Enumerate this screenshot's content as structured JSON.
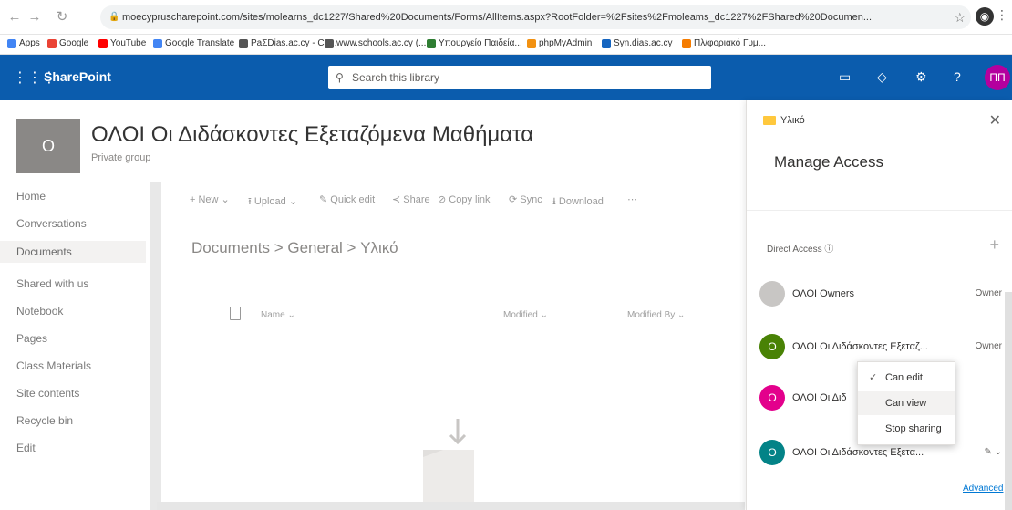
{
  "browser": {
    "url": "moecypruscharepoint.com/sites/molearns_dc1227/Shared%20Documents/Forms/AllItems.aspx?RootFolder=%2Fsites%2Fmoleams_dc1227%2FShared%20Documen...",
    "bookmarks": [
      "Apps",
      "Google",
      "YouTube",
      "Google Translate",
      "PaΣDias.ac.cy - Co...",
      "www.schools.ac.cy (...",
      "Υπουργείο Παιδεία...",
      "phpMyAdmin",
      "Syn.dias.ac.cy",
      "Πλ/φοριακό Γυμ..."
    ]
  },
  "suitebar": {
    "app_name": "SharePoint",
    "search_placeholder": "Search this library",
    "user_initials": "ΠΠ"
  },
  "site": {
    "logo_letter": "O",
    "title": "ΟΛΟΙ Οι Διδάσκοντες Εξεταζόμενα Μαθήματα",
    "subtitle": "Private group"
  },
  "leftnav": [
    "Home",
    "Conversations",
    "Documents",
    "Shared with us",
    "Notebook",
    "Pages",
    "Class Materials",
    "Site contents",
    "Recycle bin",
    "Edit"
  ],
  "commandbar": [
    "+ New ⌄",
    "⭱ Upload ⌄",
    "✎ Quick edit",
    "≺ Share",
    "⊘ Copy link",
    "⟳ Sync",
    "⭳ Download",
    "⋯"
  ],
  "breadcrumb": "Documents  >  General  >  Υλικό",
  "list": {
    "col_name": "Name ⌄",
    "col_modified": "Modified ⌄",
    "col_modified_by": "Modified By ⌄"
  },
  "panel": {
    "folder_name": "Υλικό",
    "heading": "Manage Access",
    "direct_access": "Direct Access ⓘ",
    "people": [
      {
        "initial": "",
        "name": "ΟΛΟΙ Owners",
        "role": "Owner",
        "color": "#c8c6c4"
      },
      {
        "initial": "O",
        "name": "ΟΛΟΙ Οι Διδάσκοντες Εξεταζ...",
        "role": "Owner",
        "color": "#498205"
      },
      {
        "initial": "O",
        "name": "ΟΛΟΙ Οι Διδ",
        "role": "",
        "color": "#e3008c"
      },
      {
        "initial": "O",
        "name": "ΟΛΟΙ Οι Διδάσκοντες Εξετα...",
        "role": "",
        "color": "#038387"
      }
    ],
    "menu": [
      "Can edit",
      "Can view",
      "Stop sharing"
    ],
    "advanced": "Advanced"
  }
}
